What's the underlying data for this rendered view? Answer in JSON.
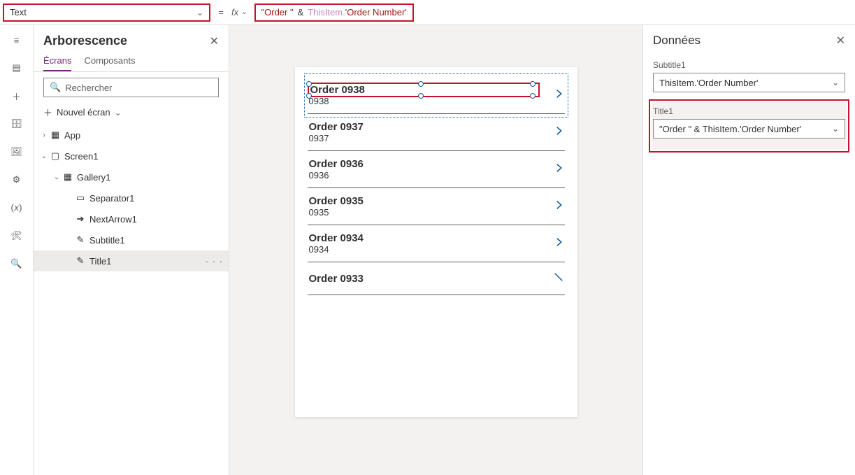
{
  "formula_bar": {
    "property": "Text",
    "fx_label": "fx",
    "formula_string": "\"Order \"",
    "formula_amp": "&",
    "formula_this": "ThisItem.",
    "formula_field": "'Order Number'"
  },
  "tree_panel": {
    "title": "Arborescence",
    "tabs": {
      "screens": "Écrans",
      "components": "Composants"
    },
    "search_placeholder": "Rechercher",
    "new_screen": "Nouvel écran",
    "nodes": {
      "app": "App",
      "screen1": "Screen1",
      "gallery1": "Gallery1",
      "separator1": "Separator1",
      "nextarrow1": "NextArrow1",
      "subtitle1": "Subtitle1",
      "title1": "Title1"
    }
  },
  "gallery_items": [
    {
      "title": "Order 0938",
      "sub": "0938",
      "selected": true
    },
    {
      "title": "Order 0937",
      "sub": "0937",
      "selected": false
    },
    {
      "title": "Order 0936",
      "sub": "0936",
      "selected": false
    },
    {
      "title": "Order 0935",
      "sub": "0935",
      "selected": false
    },
    {
      "title": "Order 0934",
      "sub": "0934",
      "selected": false
    },
    {
      "title": "Order 0933",
      "sub": "",
      "selected": false
    }
  ],
  "data_panel": {
    "title": "Données",
    "subtitle_label": "Subtitle1",
    "subtitle_value": "ThisItem.'Order Number'",
    "title_label": "Title1",
    "title_value": "\"Order \" & ThisItem.'Order Number'"
  }
}
